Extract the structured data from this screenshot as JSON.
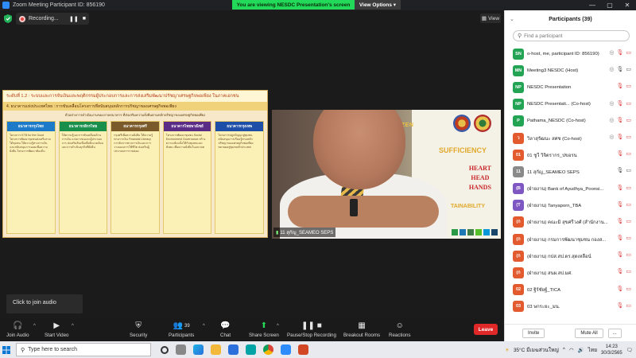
{
  "window": {
    "title": "Zoom Meeting Participant ID: 856190",
    "banner": "You are viewing NESDC Presentation's screen",
    "view_options": "View Options"
  },
  "meeting": {
    "recording_label": "Recording...",
    "view_label": "View",
    "tooltip": "Click to join audio"
  },
  "slide": {
    "title": "ระดับที่ 1.2 : ระบบและการจับเงินและพฤติกรรมผู้ประกอบการและการส่งเสริมพัฒนาปรัชญาเศรษฐกิจพอเพียง ในภาคเอกชน",
    "subtitle": "4. ธนาคารแห่งประเทศไทย : การขับเคลื่อนโครงการที่สนับสนุนหลักการปรัชญาของเศรษฐกิจพอเพียง",
    "note": "ตัวอย่างการดำเนินงานของภาคธนาคาร ที่ส่งเสริมความยั่งยืนตามหลักปรัชญาของเศรษฐกิจพอเพียง",
    "cards": [
      {
        "logo": "ธนาคารกรุงไทย",
        "color": "#1c7ac8",
        "text": "โครงการ KTB for the Good โครงการพัฒนาชุมชนส่งเสริมรายได้ชุมชน ให้ความรู้ทางการเงินและสนับสนุนการออมเพื่อความยั่งยืน โครงการพัฒนาท้องถิ่น"
      },
      {
        "logo": "ธนาคารกสิกรไทย",
        "color": "#1a8f4b",
        "text": "ให้ความรู้และการขับเคลื่อนด้านการเงิน แก่เยาวชนและผู้ประกอบการ ส่งเสริมสินเชื่อเพื่อสิ่งแวดล้อม และการดำเนินธุรกิจที่ยั่งยืน"
      },
      {
        "logo": "ธนาคารกรุงศรี",
        "color": "#7a5a2a",
        "text": "กรุงศรีเพื่อความยั่งยืน ให้ความรู้ทางการเงิน Financial Literacy การจัดการทางการเงินและการวางแผนการใช้ชีวิต ส่งเสริมผู้ประกอบการรายย่อย"
      },
      {
        "logo": "ธนาคารไทยพาณิชย์",
        "color": "#5b2c86",
        "text": "โครงการพัฒนาชุมชน Social Environment Governance สร้างความเข้มแข็งให้กับชุมชนและสังคม เพื่อความยั่งยืนในอนาคต"
      },
      {
        "logo": "ธนาคารกรุงเทพ",
        "color": "#1d4fa8",
        "text": "โครงการปลูกปัญญาสู่ชุมชน สนับสนุนการเรียนรู้ตามหลักปรัชญาของเศรษฐกิจพอเพียง ขยายผลสู่ชุมชนทั่วประเทศ"
      }
    ]
  },
  "video": {
    "citizen_text": "AL CITIZEN",
    "sufficiency": "SUFFICIENCY",
    "heart": "HEART",
    "head": "HEAD",
    "hands": "HANDS",
    "sustainability": "TAINABILITY",
    "name": "11 สุกัญ_SEAMEO SEPS"
  },
  "toolbar": {
    "join_audio": "Join Audio",
    "start_video": "Start Video",
    "security": "Security",
    "participants": "Participants",
    "participants_count": "39",
    "chat": "Chat",
    "share_screen": "Share Screen",
    "pause_recording": "Pause/Stop Recording",
    "breakout_rooms": "Breakout Rooms",
    "reactions": "Reactions",
    "leave": "Leave"
  },
  "panel": {
    "title": "Participants (39)",
    "search_placeholder": "Find a participant",
    "invite": "Invite",
    "mute_all": "Mute All",
    "more": "..."
  },
  "participants": [
    {
      "initials": "SN",
      "color": "#23a455",
      "name": "o-host, me, participant ID: 856190)",
      "mic": "muted",
      "cam": "off",
      "rec": true
    },
    {
      "initials": "MN",
      "color": "#23a455",
      "name": "Meeting3 NESDC (Host)",
      "mic": "on",
      "cam": "on",
      "rec": true
    },
    {
      "initials": "NP",
      "color": "#23a455",
      "name": "NESDC Presentation",
      "mic": "muted",
      "cam": "off",
      "rec": false
    },
    {
      "initials": "NP",
      "color": "#23a455",
      "name": "NESDC Presentati... (Co-host)",
      "mic": "muted",
      "cam": "off",
      "rec": true
    },
    {
      "initials": "P",
      "color": "#23a455",
      "name": "Pathama_NESDC (Co-host)",
      "mic": "muted",
      "cam": "off",
      "rec": true
    },
    {
      "initials": "ว",
      "color": "#e35a2e",
      "name": "วิลาสุรัฒนะ สศช (Co-host)",
      "mic": "muted",
      "cam": "off",
      "rec": true
    },
    {
      "initials": "01",
      "color": "#e35a2e",
      "name": "01 ชูวี วิจิตรากร_ปขอรน",
      "mic": "muted",
      "cam": "off",
      "rec": false
    },
    {
      "initials": "11",
      "color": "#8a8a8a",
      "name": "11 สุกัญ_SEAMEO SEPS",
      "mic": "on",
      "cam": "on",
      "rec": false
    },
    {
      "initials": "(B",
      "color": "#7e57c2",
      "name": "(ฝ่ายงาน) Bank of Ayudhya_Poonsi...",
      "mic": "muted",
      "cam": "off",
      "rec": false
    },
    {
      "initials": "(T",
      "color": "#7e57c2",
      "name": "(ฝ่ายงาน) Tanyaporn_TBA",
      "mic": "muted",
      "cam": "off",
      "rec": false
    },
    {
      "initials": "(ก",
      "color": "#e35a2e",
      "name": "(ฝ่ายงาน) คณะมิ สุขศรีวงศ์ (สำนักงาน...",
      "mic": "muted",
      "cam": "off",
      "rec": false
    },
    {
      "initials": "(ก",
      "color": "#e35a2e",
      "name": "(ฝ่ายงาน) กรมการพัฒนาชุมชน กองส...",
      "mic": "muted",
      "cam": "off",
      "rec": false
    },
    {
      "initials": "(ก",
      "color": "#e35a2e",
      "name": "(ฝ่ายงาน) กปส.สป.ดร.สุดเหลือน์",
      "mic": "muted",
      "cam": "off",
      "rec": false
    },
    {
      "initials": "(ก",
      "color": "#e35a2e",
      "name": "(ฝ่ายงาน) สนผ.สป.มศ.",
      "mic": "muted",
      "cam": "off",
      "rec": false
    },
    {
      "initials": "02",
      "color": "#e35a2e",
      "name": "02 ฐิร์ชัยฐ์_TICA",
      "mic": "muted",
      "cam": "off",
      "rec": false
    },
    {
      "initials": "03",
      "color": "#e35a2e",
      "name": "03 ษกระยะ_มน.",
      "mic": "muted",
      "cam": "off",
      "rec": false
    }
  ],
  "taskbar": {
    "search_placeholder": "Type here to search",
    "weather": "35°C มีเมฆส่วนใหญ่",
    "lang": "ไทย",
    "time": "14:23",
    "date": "30/3/2565"
  }
}
